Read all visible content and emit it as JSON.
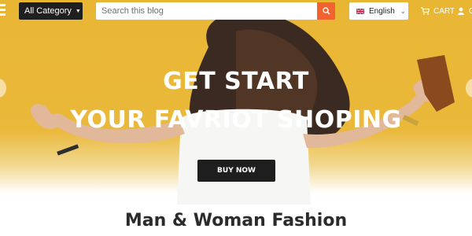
{
  "header": {
    "category_button": {
      "label": "All Category"
    },
    "search": {
      "placeholder": "Search this blog",
      "value": ""
    },
    "language": {
      "selected": "English",
      "flag_icon": "uk-flag-icon"
    },
    "cart": {
      "label": "CART",
      "icon": "cart-icon"
    },
    "user": {
      "label": "O",
      "icon": "user-icon"
    }
  },
  "hero": {
    "line1": "GET START",
    "line2": "YOUR FAVRIOT SHOPING",
    "cta_label": "BUY NOW"
  },
  "section": {
    "title": "Man & Woman Fashion"
  },
  "colors": {
    "hero_yellow": "#e9b634",
    "search_button": "#f2622e",
    "dark_button": "#1e1e1e",
    "text_white": "#ffffff"
  }
}
